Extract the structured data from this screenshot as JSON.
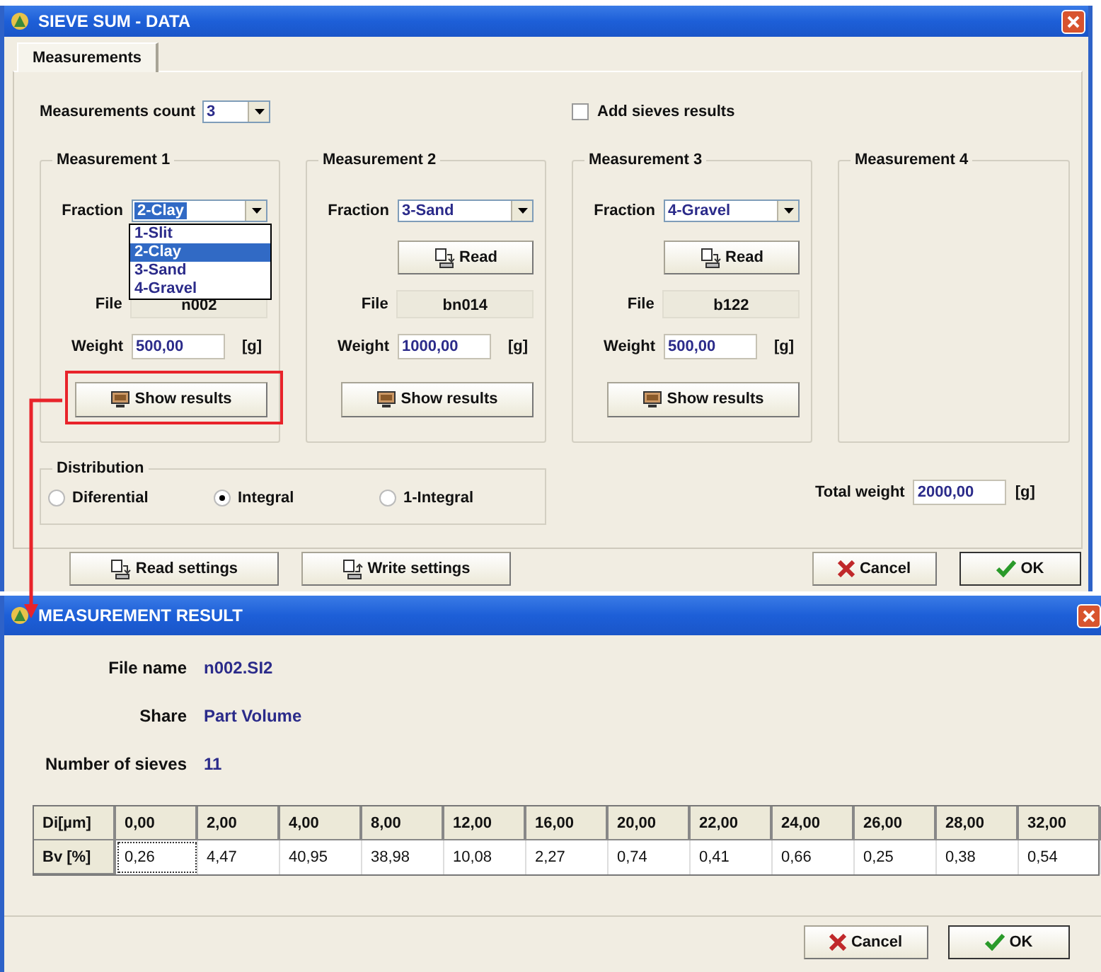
{
  "window": {
    "title": "SIEVE SUM - DATA"
  },
  "tabs": [
    {
      "label": "Measurements",
      "selected": true
    }
  ],
  "measurements_count": {
    "label": "Measurements count",
    "value": "3"
  },
  "add_sieves": {
    "label": "Add sieves results",
    "checked": false
  },
  "measurements": [
    {
      "kind": "filled",
      "title": "Measurement 1",
      "fraction_label": "Fraction",
      "fraction": "2-Clay",
      "options": [
        {
          "label": "1-Slit",
          "selected": false
        },
        {
          "label": "2-Clay",
          "selected": true
        },
        {
          "label": "3-Sand",
          "selected": false
        },
        {
          "label": "4-Gravel",
          "selected": false
        }
      ],
      "file_label": "File",
      "file": "n002",
      "weight_label": "Weight",
      "weight": "500,00",
      "unit": "[g]",
      "show_button": "Show results",
      "highlighted": true
    },
    {
      "kind": "filled",
      "title": "Measurement 2",
      "fraction_label": "Fraction",
      "fraction": "3-Sand",
      "read_button": "Read",
      "file_label": "File",
      "file": "bn014",
      "weight_label": "Weight",
      "weight": "1000,00",
      "unit": "[g]",
      "show_button": "Show results",
      "highlighted": false
    },
    {
      "kind": "filled",
      "title": "Measurement 3",
      "fraction_label": "Fraction",
      "fraction": "4-Gravel",
      "read_button": "Read",
      "file_label": "File",
      "file": "b122",
      "weight_label": "Weight",
      "weight": "500,00",
      "unit": "[g]",
      "show_button": "Show results",
      "highlighted": false
    },
    {
      "kind": "empty",
      "title": "Measurement 4"
    }
  ],
  "distribution": {
    "title": "Distribution",
    "options": [
      {
        "label": "Diferential",
        "selected": false
      },
      {
        "label": "Integral",
        "selected": true
      },
      {
        "label": "1-Integral",
        "selected": false
      }
    ]
  },
  "total_weight": {
    "label": "Total weight",
    "value": "2000,00",
    "unit": "[g]"
  },
  "buttons": [
    {
      "label": "Read settings",
      "kind": "read"
    },
    {
      "label": "Write settings",
      "kind": "write"
    },
    {
      "label": "Cancel",
      "kind": "cancel"
    },
    {
      "label": "OK",
      "kind": "ok"
    }
  ],
  "result_window": {
    "title": "MEASUREMENT RESULT",
    "fields": [
      {
        "label": "File name",
        "value": "n002.SI2"
      },
      {
        "label": "Share",
        "value": "Part Volume"
      },
      {
        "label": "Number of sieves",
        "value": "11"
      }
    ],
    "table": {
      "header": [
        "Di[µm]",
        "0,00",
        "2,00",
        "4,00",
        "8,00",
        "12,00",
        "16,00",
        "20,00",
        "22,00",
        "24,00",
        "26,00",
        "28,00",
        "32,00"
      ],
      "row_label": "Bv [%]",
      "row": [
        {
          "text": "0,26",
          "focused": true
        },
        {
          "text": "4,47",
          "focused": false
        },
        {
          "text": "40,95",
          "focused": false
        },
        {
          "text": "38,98",
          "focused": false
        },
        {
          "text": "10,08",
          "focused": false
        },
        {
          "text": "2,27",
          "focused": false
        },
        {
          "text": "0,74",
          "focused": false
        },
        {
          "text": "0,41",
          "focused": false
        },
        {
          "text": "0,66",
          "focused": false
        },
        {
          "text": "0,25",
          "focused": false
        },
        {
          "text": "0,38",
          "focused": false
        },
        {
          "text": "0,54",
          "focused": false
        }
      ]
    },
    "buttons": [
      {
        "label": "Cancel",
        "kind": "cancel"
      },
      {
        "label": "OK",
        "kind": "ok"
      }
    ]
  }
}
